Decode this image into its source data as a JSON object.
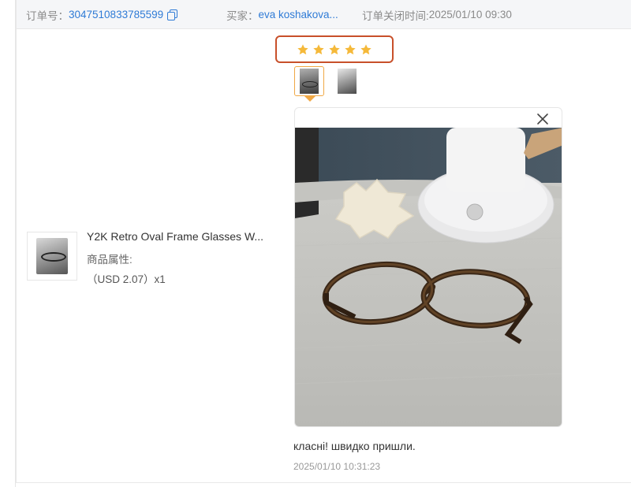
{
  "order": {
    "number_label": "订单号：",
    "number": "3047510833785599",
    "buyer_label": "买家：",
    "buyer": "eva koshakova...",
    "close_time_label": "订单关闭时间:",
    "close_time": "2025/01/10 09:30"
  },
  "product": {
    "title": "Y2K Retro Oval Frame Glasses W...",
    "attr_label": "商品属性:",
    "price": "（USD  2.07）x1"
  },
  "review": {
    "rating": 5,
    "rating_max": 5,
    "star_color": "#f5b93a",
    "highlight_color": "#c8502a",
    "text": "класні! швидко пришли.",
    "time": "2025/01/10 10:31:23",
    "images_count": 2
  },
  "colors": {
    "link": "#2f7bd6",
    "thumb_active_border": "#f0a845"
  }
}
